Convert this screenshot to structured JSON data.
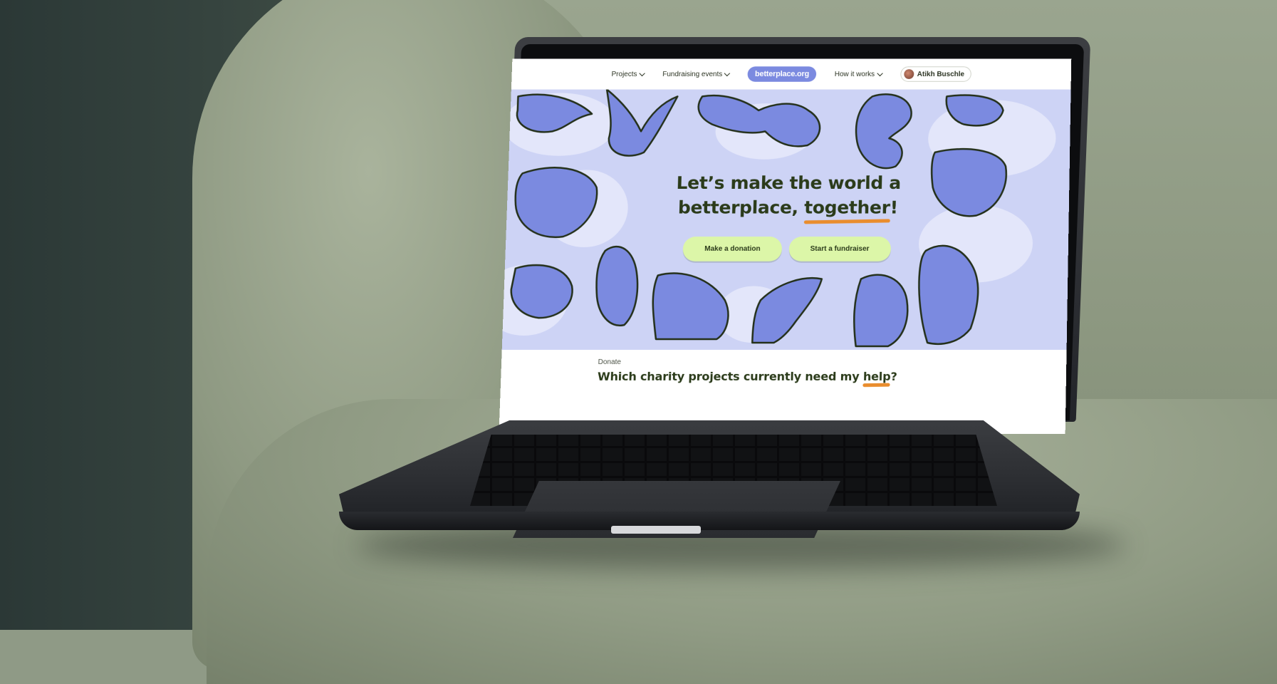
{
  "nav": {
    "projects_label": "Projects",
    "fundraising_label": "Fundraising events",
    "logo_text": "betterplace.org",
    "how_it_works_label": "How it works",
    "user_name": "Atikh Buschle"
  },
  "hero": {
    "headline_line1": "Let’s make the world a",
    "headline_line2_prefix": "betterplace, ",
    "headline_highlight": "together",
    "headline_suffix": "!",
    "donate_button": "Make a donation",
    "fundraiser_button": "Start a fundraiser"
  },
  "section": {
    "eyebrow": "Donate",
    "title_prefix": "Which charity projects currently need my ",
    "title_highlight": "help",
    "title_suffix": "?"
  },
  "colors": {
    "hero_bg": "#cdd3f5",
    "hand_fill": "#7b8ae0",
    "cta_bg": "#dcf6a8",
    "accent_underline": "#e98d2e",
    "text_dark": "#2b3b1a"
  },
  "icons": [
    "chevron-down-icon",
    "avatar",
    "hand-illustration"
  ]
}
